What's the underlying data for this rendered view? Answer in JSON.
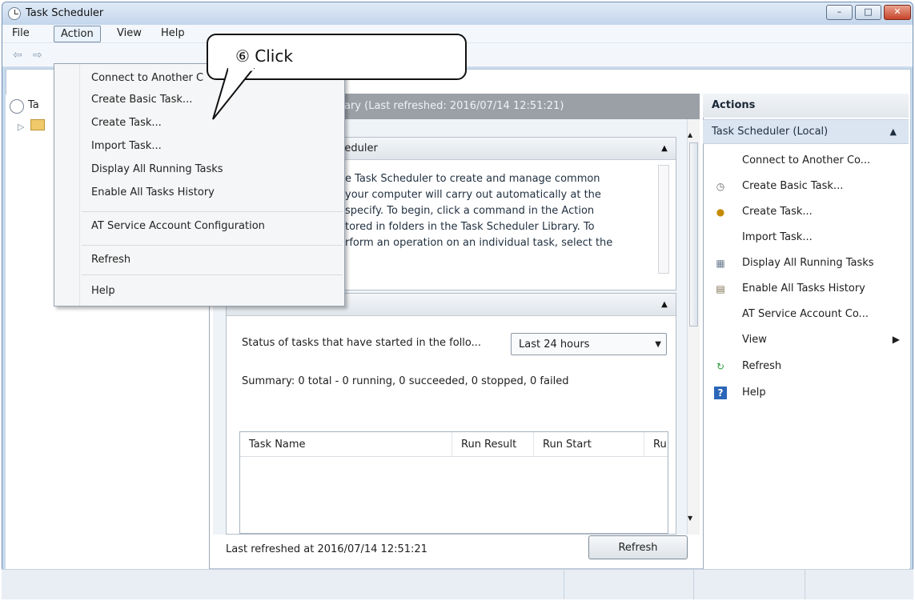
{
  "window": {
    "title": "Task Scheduler",
    "minimize": "–",
    "maximize": "□",
    "close": "✕"
  },
  "menu": {
    "file": "File",
    "action": "Action",
    "view": "View",
    "help": "Help"
  },
  "callout": {
    "text": "⑥  Click"
  },
  "action_menu": {
    "items": [
      "Connect to Another C",
      "Create Basic Task...",
      "Create Task...",
      "Import Task...",
      "Display All Running Tasks",
      "Enable All Tasks History",
      "AT Service Account Configuration",
      "Refresh",
      "Help"
    ]
  },
  "tree": {
    "root_label": "Ta",
    "child_expand": "▷"
  },
  "center": {
    "header": "ary (Last refreshed: 2016/07/14 12:51:21)",
    "overview_title": "cheduler",
    "overview_text": [
      "e Task Scheduler to create and manage common",
      "your computer will carry out automatically at the",
      "specify. To begin, click a command in the Action",
      "",
      "tored in folders in the Task Scheduler Library. To",
      "rform an operation on an individual task, select the"
    ],
    "status_label": "Status of tasks that have started in the follo...",
    "dropdown_value": "Last 24 hours",
    "summary": "Summary: 0 total - 0 running, 0 succeeded, 0 stopped, 0 failed",
    "table_headers": [
      "Task Name",
      "Run Result",
      "Run Start",
      "Ru"
    ],
    "last_refreshed": "Last refreshed at 2016/07/14 12:51:21",
    "refresh_button": "Refresh"
  },
  "actions": {
    "title": "Actions",
    "group": "Task Scheduler (Local)",
    "items": [
      {
        "label": "Connect to Another Co...",
        "icon": ""
      },
      {
        "label": "Create Basic Task...",
        "icon": "calendar-clock-icon"
      },
      {
        "label": "Create Task...",
        "icon": "task-icon"
      },
      {
        "label": "Import Task...",
        "icon": ""
      },
      {
        "label": "Display All Running Tasks",
        "icon": "running-tasks-icon"
      },
      {
        "label": "Enable All Tasks History",
        "icon": "history-icon"
      },
      {
        "label": "AT Service Account Co...",
        "icon": ""
      },
      {
        "label": "View",
        "icon": ""
      },
      {
        "label": "Refresh",
        "icon": "refresh-icon"
      },
      {
        "label": "Help",
        "icon": "help-icon"
      }
    ]
  }
}
